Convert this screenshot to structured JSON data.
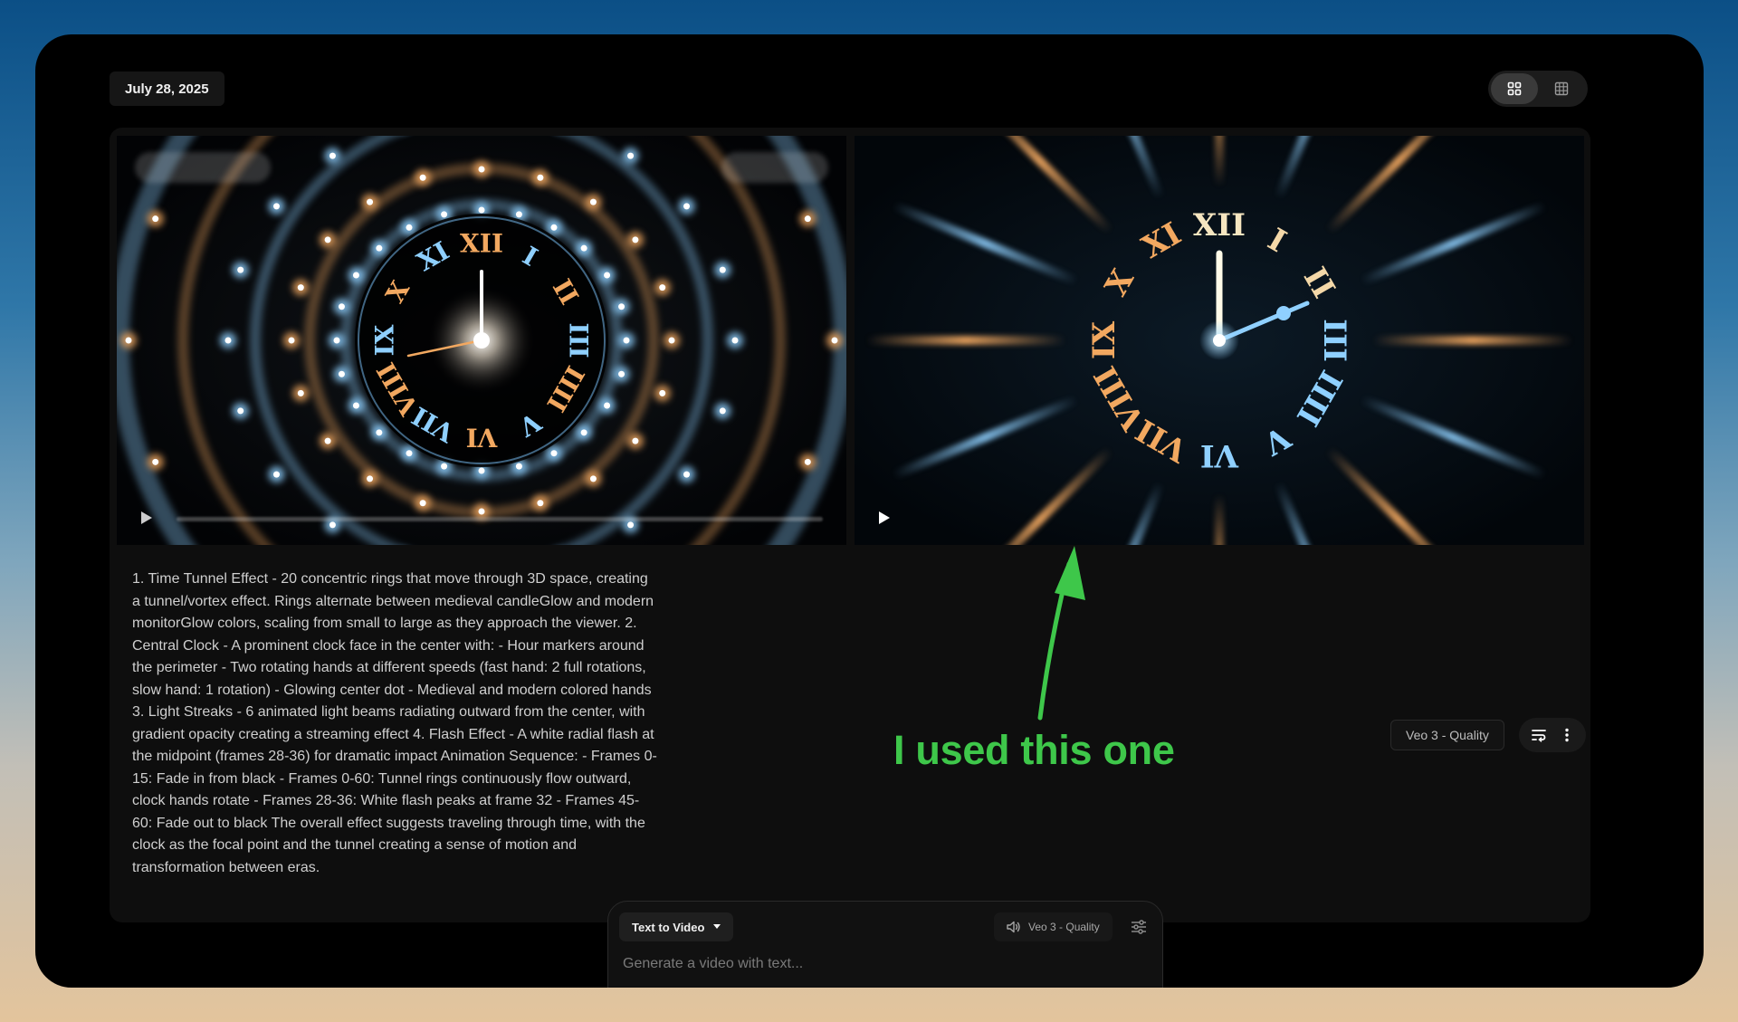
{
  "header": {
    "date": "July 28, 2025"
  },
  "view_toggle": {
    "grid_icon": "grid-2x2-icon",
    "table_icon": "grid-3x3-icon"
  },
  "clip_left": {
    "numerals": [
      "XII",
      "I",
      "II",
      "III",
      "IIII",
      "V",
      "VI",
      "VII",
      "VIII",
      "IX",
      "X",
      "XI"
    ]
  },
  "clip_right": {
    "numerals": [
      "XII",
      "I",
      "II",
      "III",
      "IIII",
      "V",
      "VI",
      "VII",
      "VIII",
      "IX",
      "X",
      "XI"
    ]
  },
  "prompt": {
    "text": "1. Time Tunnel Effect - 20 concentric rings that move through 3D space, creating a tunnel/vortex effect. Rings alternate between medieval candleGlow and modern monitorGlow colors, scaling from small to large as they approach the viewer. 2. Central Clock - A prominent clock face in the center with: - Hour markers around the perimeter - Two rotating hands at different speeds (fast hand: 2 full rotations, slow hand: 1 rotation) - Glowing center dot - Medieval and modern colored hands 3. Light Streaks - 6 animated light beams radiating outward from the center, with gradient opacity creating a streaming effect 4. Flash Effect - A white radial flash at the midpoint (frames 28-36) for dramatic impact Animation Sequence: - Frames 0-15: Fade in from black - Frames 0-60: Tunnel rings continuously flow outward, clock hands rotate - Frames 28-36: White flash peaks at frame 32 - Frames 45-60: Fade out to black The overall effect suggests traveling through time, with the clock as the focal point and the tunnel creating a sense of motion and transformation between eras."
  },
  "result": {
    "model_label": "Veo 3 - Quality"
  },
  "annotation": {
    "text": "I used this one",
    "color": "#3ec74a"
  },
  "composer": {
    "mode_label": "Text to Video",
    "model_label": "Veo 3 - Quality",
    "placeholder": "Generate a video with text..."
  },
  "colors": {
    "warm": "#f2a860",
    "cool": "#8fd0ff"
  }
}
